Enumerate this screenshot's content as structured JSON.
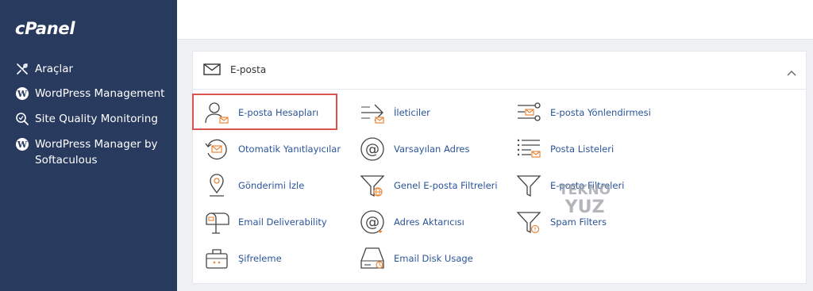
{
  "sidebar": {
    "logo": "cPanel",
    "items": [
      {
        "label": "Araçlar",
        "icon": "tools-icon"
      },
      {
        "label": "WordPress Management",
        "icon": "wordpress-icon"
      },
      {
        "label": "Site Quality Monitoring",
        "icon": "search-quality-icon"
      },
      {
        "label": "WordPress Manager by Softaculous",
        "icon": "wordpress-icon"
      }
    ]
  },
  "panel": {
    "title": "E-posta",
    "items": [
      {
        "label": "E-posta Hesapları",
        "icon": "email-accounts-icon"
      },
      {
        "label": "İleticiler",
        "icon": "forwarders-icon"
      },
      {
        "label": "E-posta Yönlendirmesi",
        "icon": "email-routing-icon"
      },
      {
        "label": "Otomatik Yanıtlayıcılar",
        "icon": "autoresponder-icon"
      },
      {
        "label": "Varsayılan Adres",
        "icon": "at-sign-icon"
      },
      {
        "label": "Posta Listeleri",
        "icon": "mailing-list-icon"
      },
      {
        "label": "Gönderimi İzle",
        "icon": "track-delivery-icon"
      },
      {
        "label": "Genel E-posta Filtreleri",
        "icon": "global-filter-icon"
      },
      {
        "label": "E-posta Filtreleri",
        "icon": "email-filter-icon"
      },
      {
        "label": "Email Deliverability",
        "icon": "mailbox-icon"
      },
      {
        "label": "Adres Aktarıcısı",
        "icon": "address-importer-icon"
      },
      {
        "label": "Spam Filters",
        "icon": "spam-filter-icon"
      },
      {
        "label": "Şifreleme",
        "icon": "encryption-icon"
      },
      {
        "label": "Email Disk Usage",
        "icon": "disk-usage-icon"
      }
    ]
  },
  "watermark": {
    "line1": "TEKNO",
    "line2": "YUZ"
  },
  "colors": {
    "sidebar": "#293a5f",
    "link": "#2b5599",
    "accent": "#e8873a",
    "highlight": "#d9534f"
  }
}
